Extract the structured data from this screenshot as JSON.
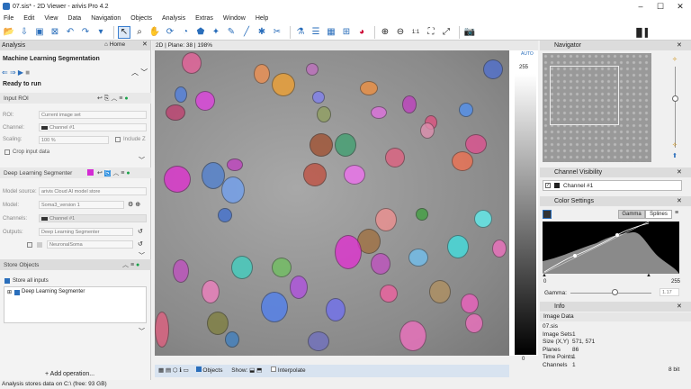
{
  "window": {
    "title": "07.sis* - 2D Viewer - arivis Pro 4.2"
  },
  "menu": [
    "File",
    "Edit",
    "View",
    "Data",
    "Navigation",
    "Objects",
    "Analysis",
    "Extras",
    "Window",
    "Help"
  ],
  "left": {
    "panel_title": "Analysis",
    "home_label": "Home",
    "pipeline_title": "Machine Learning Segmentation",
    "run_status": "Ready to run",
    "input_roi": {
      "title": "Input ROI",
      "roi_label": "ROI:",
      "roi_value": "Current image set",
      "channel_label": "Channel:",
      "channel_value": "Channel #1",
      "scaling_label": "Scaling:",
      "scaling_value": "100 %",
      "include_z": "Include Z",
      "crop": "Crop input data"
    },
    "dl": {
      "title": "Deep Learning Segmenter",
      "source_label": "Model source:",
      "source_value": "arivis Cloud AI model store",
      "model_label": "Model:",
      "model_value": "Soma3_version 1",
      "channels_label": "Channels:",
      "channels_value": "Channel #1",
      "outputs_label": "Outputs:",
      "output1": "Deep Learning Segmenter",
      "output2": "NeuronalSoma"
    },
    "store": {
      "title": "Store Objects",
      "store_all": "Store all inputs",
      "tree_item": "Deep Learning Segmenter"
    },
    "add_op": "+ Add operation..."
  },
  "viewer": {
    "mode": "2D",
    "plane": "Plane: 38",
    "zoom": "198%",
    "objects": "Objects",
    "show": "Show:",
    "interpolate": "Interpolate",
    "lut_top": "255",
    "lut_bottom": "0",
    "auto": "AUTO"
  },
  "right": {
    "navigator": "Navigator",
    "channel_visibility": "Channel Visibility",
    "channel1": "Channel #1",
    "color_settings": "Color Settings",
    "gamma_tab": "Gamma",
    "splines_tab": "Splines",
    "range_min": "0",
    "range_max": "255",
    "gamma_label": "Gamma:",
    "gamma_value": "1.17",
    "info": "Info",
    "image_data": "Image Data",
    "info_rows": [
      [
        "07.sis",
        ""
      ],
      [
        "Image Sets",
        "1"
      ],
      [
        "Size (X,Y)",
        "571, 571"
      ],
      [
        "Planes",
        "86"
      ],
      [
        "Time Points",
        "1"
      ],
      [
        "Channels",
        "1"
      ]
    ],
    "bitdepth": "8 bit"
  },
  "status": "Analysis stores data on C:\\ (free: 93 GB)"
}
